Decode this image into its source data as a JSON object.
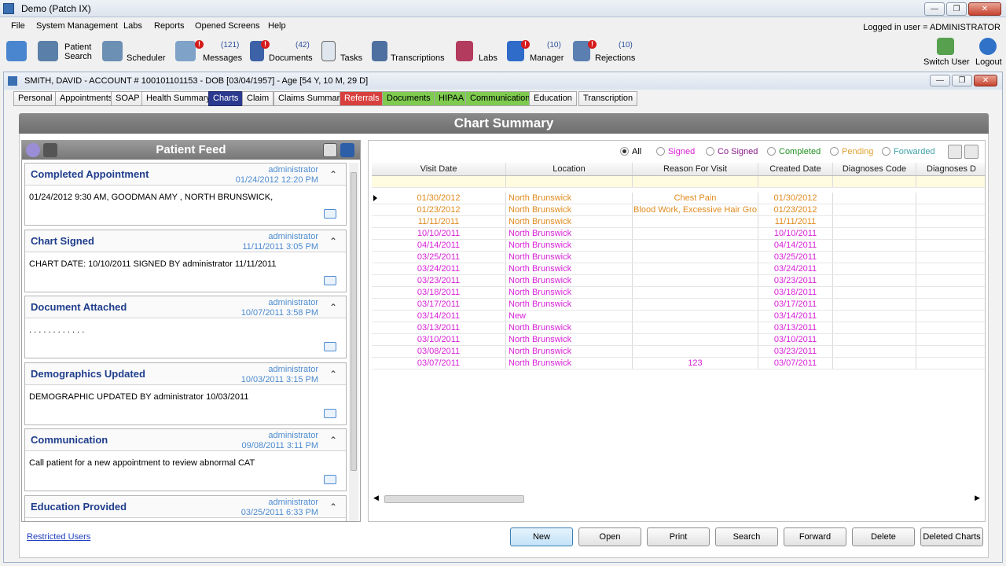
{
  "app": {
    "title": "Demo (Patch IX)",
    "logged_in": "Logged in user = ADMINISTRATOR"
  },
  "menu": [
    "File",
    "System Management",
    "Labs",
    "Reports",
    "Opened Screens",
    "Help"
  ],
  "toolbar": {
    "patient_search_1": "Patient",
    "patient_search_2": "Search",
    "scheduler": "Scheduler",
    "messages": "Messages",
    "messages_count": "(121)",
    "documents": "Documents",
    "documents_count": "(42)",
    "tasks": "Tasks",
    "transcriptions": "Transcriptions",
    "labs": "Labs",
    "manager": "Manager",
    "manager_count": "(10)",
    "rejections": "Rejections",
    "rejections_count": "(10)",
    "switch_user": "Switch User",
    "logout": "Logout"
  },
  "patient_window": {
    "title": "SMITH, DAVID - ACCOUNT # 100101101153 - DOB [03/04/1957] - Age [54 Y, 10 M, 29 D]"
  },
  "tabs": [
    "Personal",
    "Appointments",
    "SOAP",
    "Health Summary",
    "Charts",
    "Claim",
    "Claims Summary",
    "Referrals",
    "Documents",
    "HIPAA",
    "Communication",
    "Education",
    "Transcription"
  ],
  "header": {
    "title": "Chart Summary"
  },
  "feed": {
    "title": "Patient Feed",
    "cards": [
      {
        "title": "Completed Appointment",
        "user": "administrator",
        "date": "01/24/2012 12:20 PM",
        "body": "01/24/2012 9:30 AM, GOODMAN AMY  , NORTH BRUNSWICK,"
      },
      {
        "title": "Chart Signed",
        "user": "administrator",
        "date": "11/11/2011 3:05 PM",
        "body": "CHART DATE: 10/10/2011 SIGNED BY administrator 11/11/2011"
      },
      {
        "title": "Document Attached",
        "user": "administrator",
        "date": "10/07/2011 3:58 PM",
        "body": ". . . . . . . . . . . ."
      },
      {
        "title": "Demographics Updated",
        "user": "administrator",
        "date": "10/03/2011 3:15 PM",
        "body": "DEMOGRAPHIC UPDATED BY administrator 10/03/2011"
      },
      {
        "title": "Communication",
        "user": "administrator",
        "date": "09/08/2011 3:11 PM",
        "body": "Call patient for a new appointment to review abnormal CAT"
      },
      {
        "title": "Education Provided",
        "user": "administrator",
        "date": "03/25/2011 6:33 PM",
        "body": ""
      }
    ]
  },
  "filters": {
    "all": "All",
    "signed": "Signed",
    "co_signed": "Co Signed",
    "completed": "Completed",
    "pending": "Pending",
    "forwarded": "Forwarded",
    "colors": {
      "signed": "#d81fd8",
      "co_signed": "#8b1b8b",
      "completed": "#1f8f1f",
      "pending": "#e0a030",
      "forwarded": "#3fa0a8"
    }
  },
  "grid": {
    "columns": [
      "Visit Date",
      "Location",
      "Reason For Visit",
      "Created Date",
      "Diagnoses Code",
      "Diagnoses D"
    ],
    "rows": [
      {
        "visit": "01/30/2012",
        "location": "North Brunswick",
        "reason": "Chest Pain",
        "created": "01/30/2012",
        "color": "#e08a1e"
      },
      {
        "visit": "01/23/2012",
        "location": "North Brunswick",
        "reason": "Blood Work, Excessive Hair Gro",
        "created": "01/23/2012",
        "color": "#e08a1e"
      },
      {
        "visit": "11/11/2011",
        "location": "North Brunswick",
        "reason": "",
        "created": "11/11/2011",
        "color": "#e08a1e"
      },
      {
        "visit": "10/10/2011",
        "location": "North Brunswick",
        "reason": "",
        "created": "10/10/2011",
        "color": "#d81fd8"
      },
      {
        "visit": "04/14/2011",
        "location": "North Brunswick",
        "reason": "",
        "created": "04/14/2011",
        "color": "#d81fd8"
      },
      {
        "visit": "03/25/2011",
        "location": "North Brunswick",
        "reason": "",
        "created": "03/25/2011",
        "color": "#d81fd8"
      },
      {
        "visit": "03/24/2011",
        "location": "North Brunswick",
        "reason": "",
        "created": "03/24/2011",
        "color": "#d81fd8"
      },
      {
        "visit": "03/23/2011",
        "location": "North Brunswick",
        "reason": "",
        "created": "03/23/2011",
        "color": "#d81fd8"
      },
      {
        "visit": "03/18/2011",
        "location": "North Brunswick",
        "reason": "",
        "created": "03/18/2011",
        "color": "#d81fd8"
      },
      {
        "visit": "03/17/2011",
        "location": "North Brunswick",
        "reason": "",
        "created": "03/17/2011",
        "color": "#d81fd8"
      },
      {
        "visit": "03/14/2011",
        "location": "New",
        "reason": "",
        "created": "03/14/2011",
        "color": "#d81fd8"
      },
      {
        "visit": "03/13/2011",
        "location": "North Brunswick",
        "reason": "",
        "created": "03/13/2011",
        "color": "#d81fd8"
      },
      {
        "visit": "03/10/2011",
        "location": "North Brunswick",
        "reason": "",
        "created": "03/10/2011",
        "color": "#d81fd8"
      },
      {
        "visit": "03/08/2011",
        "location": "North Brunswick",
        "reason": "",
        "created": "03/23/2011",
        "color": "#d81fd8"
      },
      {
        "visit": "03/07/2011",
        "location": "North Brunswick",
        "reason": "123",
        "created": "03/07/2011",
        "color": "#d81fd8"
      }
    ]
  },
  "bottom": {
    "restricted": "Restricted Users",
    "buttons": [
      "New",
      "Open",
      "Print",
      "Search",
      "Forward",
      "Delete",
      "Deleted Charts"
    ]
  }
}
